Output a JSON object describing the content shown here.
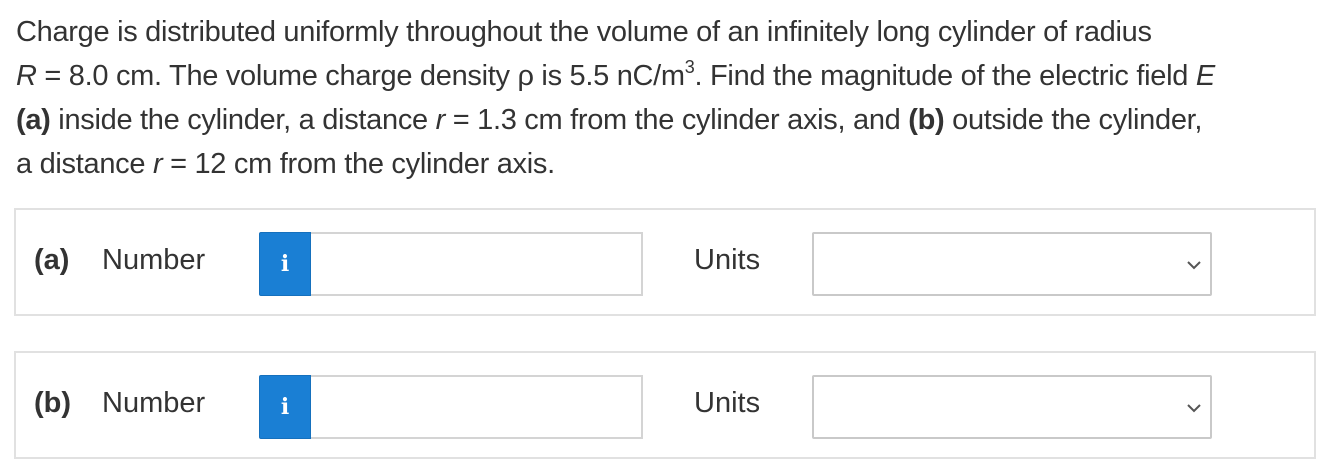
{
  "question": {
    "line1_pre": "Charge is distributed uniformly throughout the volume of an infinitely long cylinder of radius",
    "R_symbol": "R",
    "line2_a": " = 8.0 cm. The volume charge density ρ is 5.5 nC/m",
    "exp": "3",
    "line2_b": ". Find the magnitude of the electric field ",
    "E_symbol": "E",
    "part_a_label": "(a)",
    "line3_a": " inside the cylinder, a distance ",
    "r_symbol_1": "r",
    "line3_b": " = 1.3 cm from the cylinder axis, and ",
    "part_b_label": "(b)",
    "line3_c": " outside the cylinder,",
    "line4_a": "a distance ",
    "r_symbol_2": "r",
    "line4_b": " = 12 cm from the cylinder axis."
  },
  "answers": [
    {
      "part": "(a)",
      "number_label": "Number",
      "info_icon": "i",
      "value": "",
      "units_label": "Units",
      "units_selected": ""
    },
    {
      "part": "(b)",
      "number_label": "Number",
      "info_icon": "i",
      "value": "",
      "units_label": "Units",
      "units_selected": ""
    }
  ],
  "colors": {
    "info_button": "#1a7fd4",
    "border": "#e1e1e1",
    "text": "#333333"
  }
}
